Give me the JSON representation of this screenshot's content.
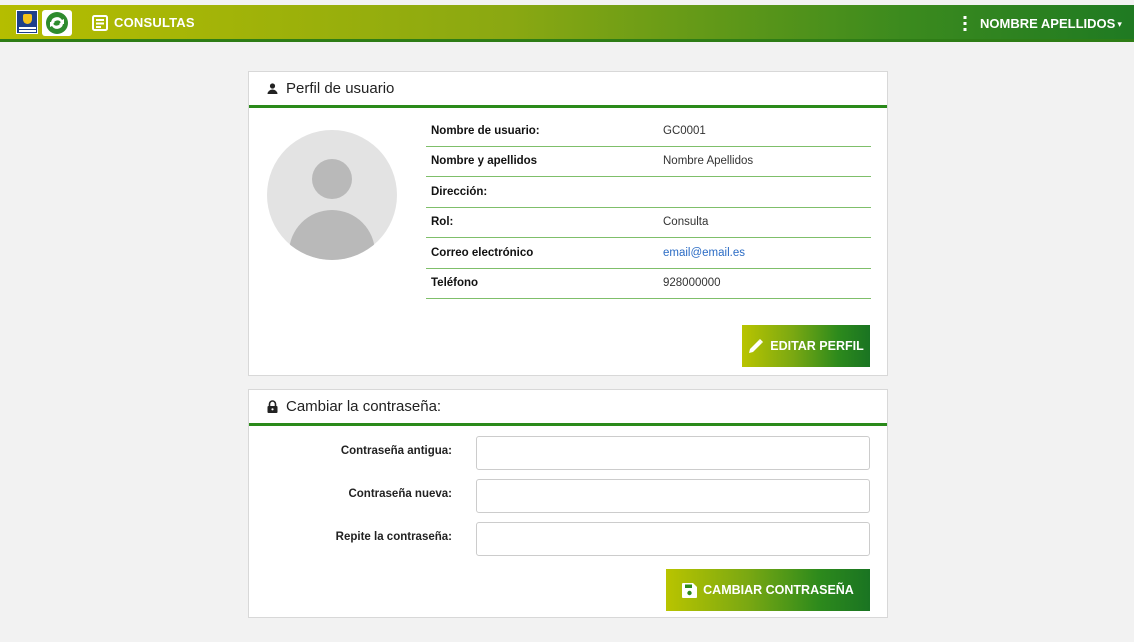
{
  "topbar": {
    "brand_label": "CONSULTAS",
    "user_menu_label": "NOMBRE APELLIDOS",
    "user_menu_caret": "▾",
    "icons": [
      "cabildo-logo-icon",
      "recycle-logo-icon",
      "document-list-icon",
      "kebab-menu-icon"
    ]
  },
  "profile": {
    "title": "Perfil de usuario",
    "fields": [
      {
        "key": "Nombre de usuario:",
        "value": "GC0001"
      },
      {
        "key": "Nombre y apellidos",
        "value": "Nombre Apellidos"
      },
      {
        "key": "Dirección:",
        "value": ""
      },
      {
        "key": "Rol:",
        "value": "Consulta"
      },
      {
        "key": "Correo electrónico",
        "value": "email@email.es"
      },
      {
        "key": "Teléfono",
        "value": "928000000"
      }
    ],
    "edit_button_label": "EDITAR PERFIL"
  },
  "password": {
    "title": "Cambiar la contraseña:",
    "old_label": "Contraseña antigua:",
    "old_value": "",
    "new_label": "Contraseña nueva:",
    "new_value": "",
    "repeat_label": "Repite la contraseña:",
    "repeat_value": "",
    "submit_label": "CAMBIAR CONTRASEÑA"
  },
  "colors": {
    "accent_green": "#2a8a1a",
    "accent_lime": "#b5bd00",
    "link_blue": "#2a6bc4"
  }
}
